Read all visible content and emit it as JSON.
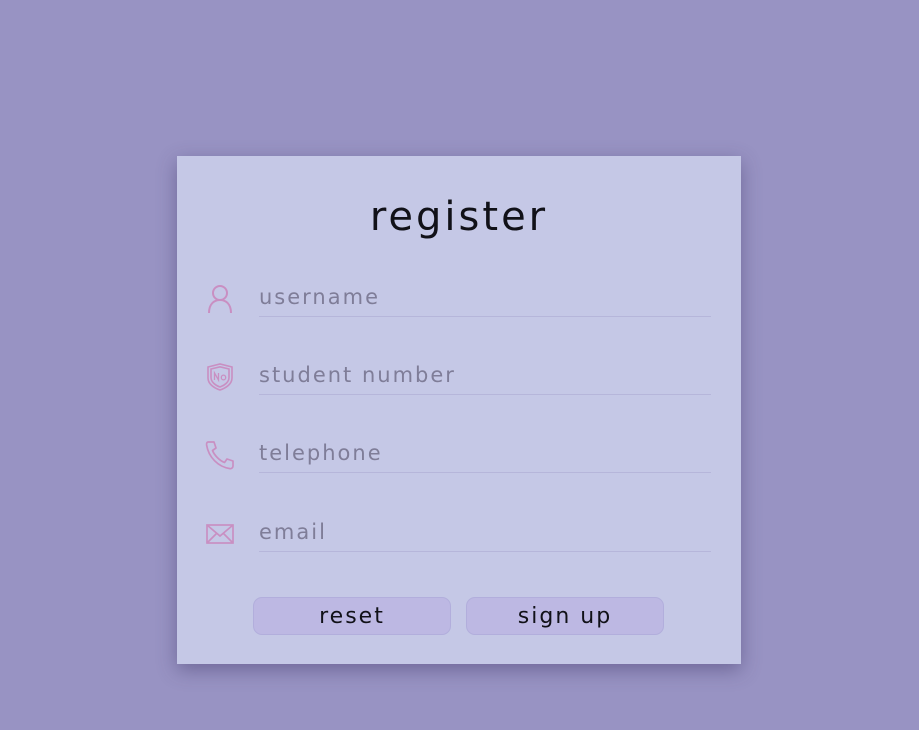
{
  "form": {
    "title": "register",
    "fields": [
      {
        "name": "username",
        "placeholder": "username",
        "icon": "user-icon"
      },
      {
        "name": "student_number",
        "placeholder": "student number",
        "icon": "shield-no-icon"
      },
      {
        "name": "telephone",
        "placeholder": "telephone",
        "icon": "phone-icon"
      },
      {
        "name": "email",
        "placeholder": "email",
        "icon": "mail-icon"
      }
    ],
    "buttons": {
      "reset_label": "reset",
      "signup_label": "sign up"
    }
  },
  "colors": {
    "background": "#9893c3",
    "card": "#c5c8e6",
    "icon": "#c98fc2",
    "button": "#bdb8e3"
  }
}
